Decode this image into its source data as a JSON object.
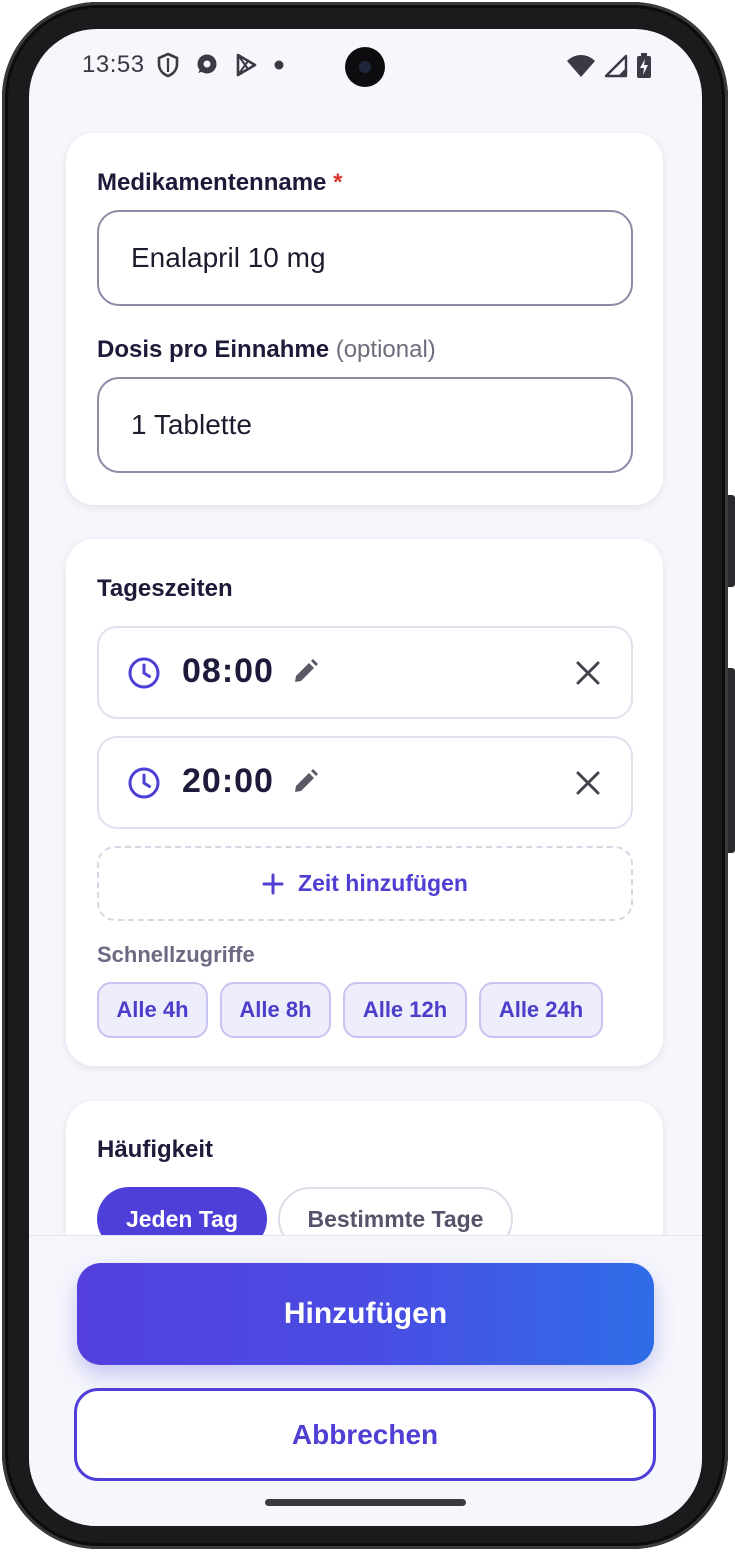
{
  "status_bar": {
    "time": "13:53",
    "icons_left": [
      "shield-icon",
      "chat-bubble-icon",
      "play-store-icon",
      "dot-icon"
    ],
    "icons_right": [
      "wifi-icon",
      "cell-signal-icon",
      "battery-charging-icon"
    ]
  },
  "medication_card": {
    "name_label": "Medikamentenname",
    "name_required_marker": "*",
    "name_value": "Enalapril 10 mg",
    "dose_label": "Dosis pro Einnahme",
    "dose_optional": "(optional)",
    "dose_value": "1 Tablette"
  },
  "times_card": {
    "title": "Tageszeiten",
    "times": [
      {
        "value": "08:00"
      },
      {
        "value": "20:00"
      }
    ],
    "add_time_label": "Zeit hinzufügen",
    "quick_access_label": "Schnellzugriffe",
    "quick_chips": [
      "Alle 4h",
      "Alle 8h",
      "Alle 12h",
      "Alle 24h"
    ]
  },
  "frequency_card": {
    "title": "Häufigkeit",
    "options": [
      "Jeden Tag",
      "Bestimmte Tage"
    ],
    "selected": "Jeden Tag"
  },
  "actions": {
    "primary_label": "Hinzufügen",
    "secondary_label": "Abbrechen"
  },
  "colors": {
    "accent": "#4d3fd8",
    "accent_gradient_end": "#2f6de8",
    "required": "#d9342b",
    "background": "#f6f7fc"
  }
}
